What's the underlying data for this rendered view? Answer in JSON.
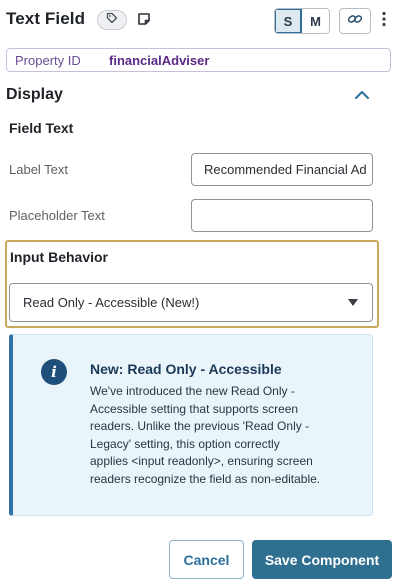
{
  "header": {
    "title": "Text Field",
    "size_options": [
      "S",
      "M"
    ],
    "selected_size": "S"
  },
  "property": {
    "label": "Property ID",
    "value": "financialAdviser"
  },
  "display": {
    "title": "Display",
    "field_text": {
      "title": "Field Text",
      "label_text_label": "Label Text",
      "label_text_value": "Recommended Financial Ad",
      "placeholder_text_label": "Placeholder Text",
      "placeholder_text_value": ""
    }
  },
  "input_behavior": {
    "title": "Input Behavior",
    "selected": "Read Only - Accessible (New!)"
  },
  "info": {
    "title": "New: Read Only - Accessible",
    "lines": [
      "We've introduced the new Read Only -",
      "Accessible setting that supports screen",
      "readers. Unlike the previous 'Read Only -",
      "Legacy' setting, this option correctly",
      "applies <input readonly>, ensuring screen",
      "readers recognize the field as non-editable."
    ],
    "icon": "info-icon"
  },
  "footer": {
    "cancel_label": "Cancel",
    "save_label": "Save Component"
  },
  "colors": {
    "accent": "#2f6f8f",
    "highlight_border": "#c9a85a",
    "info_bg": "#eaf4fb",
    "property_value": "#5b2a86"
  }
}
